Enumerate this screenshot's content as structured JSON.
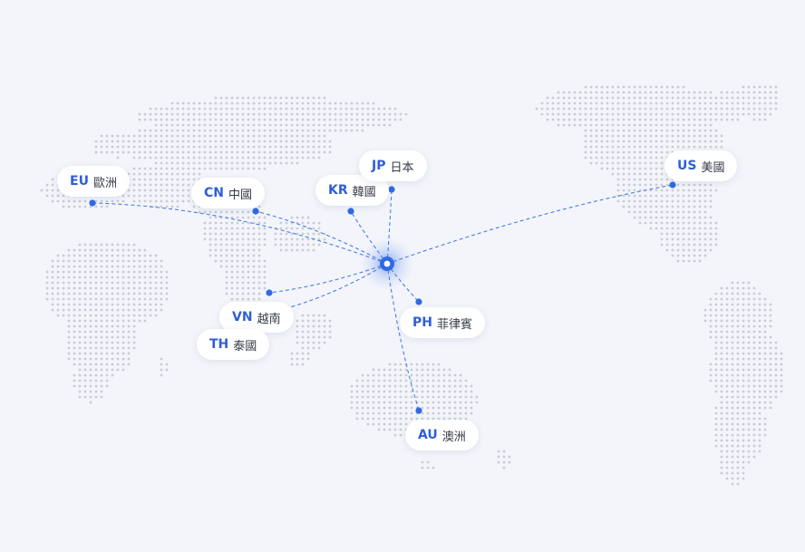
{
  "map": {
    "accent_color": "#2f6ae6",
    "dot_color": "#c9ccd4",
    "hub": {
      "name": "hub-marker"
    },
    "destinations": [
      {
        "id": "eu",
        "code": "EU",
        "name": "歐洲"
      },
      {
        "id": "cn",
        "code": "CN",
        "name": "中國"
      },
      {
        "id": "kr",
        "code": "KR",
        "name": "韓國"
      },
      {
        "id": "jp",
        "code": "JP",
        "name": "日本"
      },
      {
        "id": "us",
        "code": "US",
        "name": "美國"
      },
      {
        "id": "vn",
        "code": "VN",
        "name": "越南"
      },
      {
        "id": "th",
        "code": "TH",
        "name": "泰國"
      },
      {
        "id": "ph",
        "code": "PH",
        "name": "菲律賓"
      },
      {
        "id": "au",
        "code": "AU",
        "name": "澳洲"
      }
    ]
  }
}
